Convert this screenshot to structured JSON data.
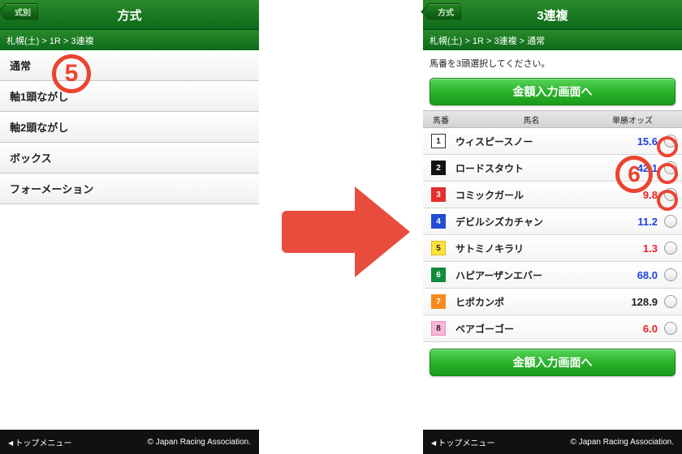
{
  "left": {
    "back_tab": "式別",
    "title": "方式",
    "breadcrumb": "札幌(土) > 1R > 3連複",
    "options": [
      "通常",
      "軸1頭ながし",
      "軸2頭ながし",
      "ボックス",
      "フォーメーション"
    ],
    "footer_left": "トップメニュー",
    "footer_right": "© Japan Racing Association."
  },
  "right": {
    "back_tab": "方式",
    "title": "3連複",
    "breadcrumb": "札幌(土) > 1R > 3連複 > 通常",
    "instruction": "馬番を3頭選択してください。",
    "button_label": "金額入力画面へ",
    "cols": {
      "num": "馬番",
      "name": "馬名",
      "odds": "単勝オッズ"
    },
    "horses": [
      {
        "num": "1",
        "cls": "nb-white",
        "name": "ウィスピースノー",
        "odds": "15.6",
        "ocls": "blue"
      },
      {
        "num": "2",
        "cls": "nb-black",
        "name": "ロードスタウト",
        "odds": "42.1",
        "ocls": "blue"
      },
      {
        "num": "3",
        "cls": "nb-red",
        "name": "コミックガール",
        "odds": "9.8",
        "ocls": "red"
      },
      {
        "num": "4",
        "cls": "nb-blue",
        "name": "デビルシズカチャン",
        "odds": "11.2",
        "ocls": "blue"
      },
      {
        "num": "5",
        "cls": "nb-yellow",
        "name": "サトミノキラリ",
        "odds": "1.3",
        "ocls": "red"
      },
      {
        "num": "6",
        "cls": "nb-green",
        "name": "ハピアーザンエバー",
        "odds": "68.0",
        "ocls": "blue"
      },
      {
        "num": "7",
        "cls": "nb-orange",
        "name": "ヒポカンポ",
        "odds": "128.9",
        "ocls": "black"
      },
      {
        "num": "8",
        "cls": "nb-pink",
        "name": "ベアゴーゴー",
        "odds": "6.0",
        "ocls": "red"
      }
    ],
    "footer_left": "トップメニュー",
    "footer_right": "© Japan Racing Association."
  },
  "callouts": {
    "five": "5",
    "six": "6"
  }
}
